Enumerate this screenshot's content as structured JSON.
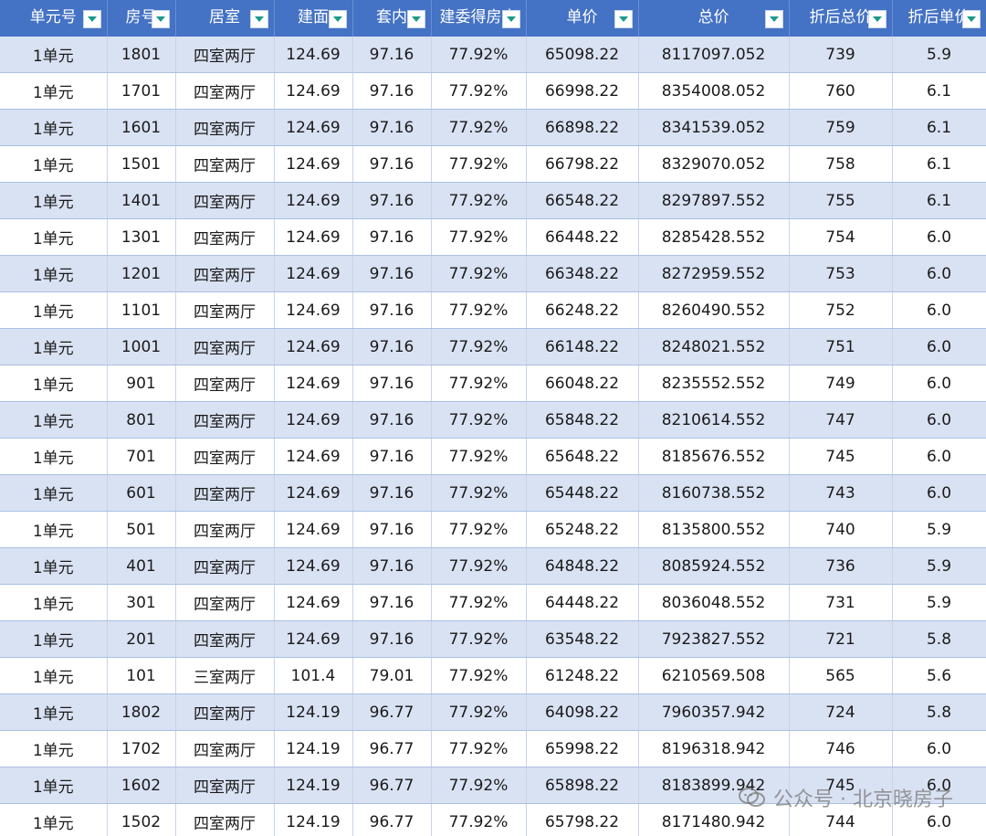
{
  "headers": [
    "单元号",
    "房号",
    "居室",
    "建面",
    "套内",
    "建委得房率",
    "单价",
    "总价",
    "折后总价",
    "折后单价"
  ],
  "rows": [
    [
      "1单元",
      "1801",
      "四室两厅",
      "124.69",
      "97.16",
      "77.92%",
      "65098.22",
      "8117097.052",
      "739",
      "5.9"
    ],
    [
      "1单元",
      "1701",
      "四室两厅",
      "124.69",
      "97.16",
      "77.92%",
      "66998.22",
      "8354008.052",
      "760",
      "6.1"
    ],
    [
      "1单元",
      "1601",
      "四室两厅",
      "124.69",
      "97.16",
      "77.92%",
      "66898.22",
      "8341539.052",
      "759",
      "6.1"
    ],
    [
      "1单元",
      "1501",
      "四室两厅",
      "124.69",
      "97.16",
      "77.92%",
      "66798.22",
      "8329070.052",
      "758",
      "6.1"
    ],
    [
      "1单元",
      "1401",
      "四室两厅",
      "124.69",
      "97.16",
      "77.92%",
      "66548.22",
      "8297897.552",
      "755",
      "6.1"
    ],
    [
      "1单元",
      "1301",
      "四室两厅",
      "124.69",
      "97.16",
      "77.92%",
      "66448.22",
      "8285428.552",
      "754",
      "6.0"
    ],
    [
      "1单元",
      "1201",
      "四室两厅",
      "124.69",
      "97.16",
      "77.92%",
      "66348.22",
      "8272959.552",
      "753",
      "6.0"
    ],
    [
      "1单元",
      "1101",
      "四室两厅",
      "124.69",
      "97.16",
      "77.92%",
      "66248.22",
      "8260490.552",
      "752",
      "6.0"
    ],
    [
      "1单元",
      "1001",
      "四室两厅",
      "124.69",
      "97.16",
      "77.92%",
      "66148.22",
      "8248021.552",
      "751",
      "6.0"
    ],
    [
      "1单元",
      "901",
      "四室两厅",
      "124.69",
      "97.16",
      "77.92%",
      "66048.22",
      "8235552.552",
      "749",
      "6.0"
    ],
    [
      "1单元",
      "801",
      "四室两厅",
      "124.69",
      "97.16",
      "77.92%",
      "65848.22",
      "8210614.552",
      "747",
      "6.0"
    ],
    [
      "1单元",
      "701",
      "四室两厅",
      "124.69",
      "97.16",
      "77.92%",
      "65648.22",
      "8185676.552",
      "745",
      "6.0"
    ],
    [
      "1单元",
      "601",
      "四室两厅",
      "124.69",
      "97.16",
      "77.92%",
      "65448.22",
      "8160738.552",
      "743",
      "6.0"
    ],
    [
      "1单元",
      "501",
      "四室两厅",
      "124.69",
      "97.16",
      "77.92%",
      "65248.22",
      "8135800.552",
      "740",
      "5.9"
    ],
    [
      "1单元",
      "401",
      "四室两厅",
      "124.69",
      "97.16",
      "77.92%",
      "64848.22",
      "8085924.552",
      "736",
      "5.9"
    ],
    [
      "1单元",
      "301",
      "四室两厅",
      "124.69",
      "97.16",
      "77.92%",
      "64448.22",
      "8036048.552",
      "731",
      "5.9"
    ],
    [
      "1单元",
      "201",
      "四室两厅",
      "124.69",
      "97.16",
      "77.92%",
      "63548.22",
      "7923827.552",
      "721",
      "5.8"
    ],
    [
      "1单元",
      "101",
      "三室两厅",
      "101.4",
      "79.01",
      "77.92%",
      "61248.22",
      "6210569.508",
      "565",
      "5.6"
    ],
    [
      "1单元",
      "1802",
      "四室两厅",
      "124.19",
      "96.77",
      "77.92%",
      "64098.22",
      "7960357.942",
      "724",
      "5.8"
    ],
    [
      "1单元",
      "1702",
      "四室两厅",
      "124.19",
      "96.77",
      "77.92%",
      "65998.22",
      "8196318.942",
      "746",
      "6.0"
    ],
    [
      "1单元",
      "1602",
      "四室两厅",
      "124.19",
      "96.77",
      "77.92%",
      "65898.22",
      "8183899.942",
      "745",
      "6.0"
    ],
    [
      "1单元",
      "1502",
      "四室两厅",
      "124.19",
      "96.77",
      "77.92%",
      "65798.22",
      "8171480.942",
      "744",
      "6.0"
    ]
  ],
  "icons": {
    "filter": "filter-dropdown-icon",
    "watermark": "wechat-icon"
  },
  "watermark": {
    "text": "公众号 · 北京晓房子"
  },
  "colors": {
    "header_bg": "#4472c4",
    "header_text": "#ffffff",
    "band": "#d9e2f3",
    "filter_arrow": "#1a9a8a"
  }
}
